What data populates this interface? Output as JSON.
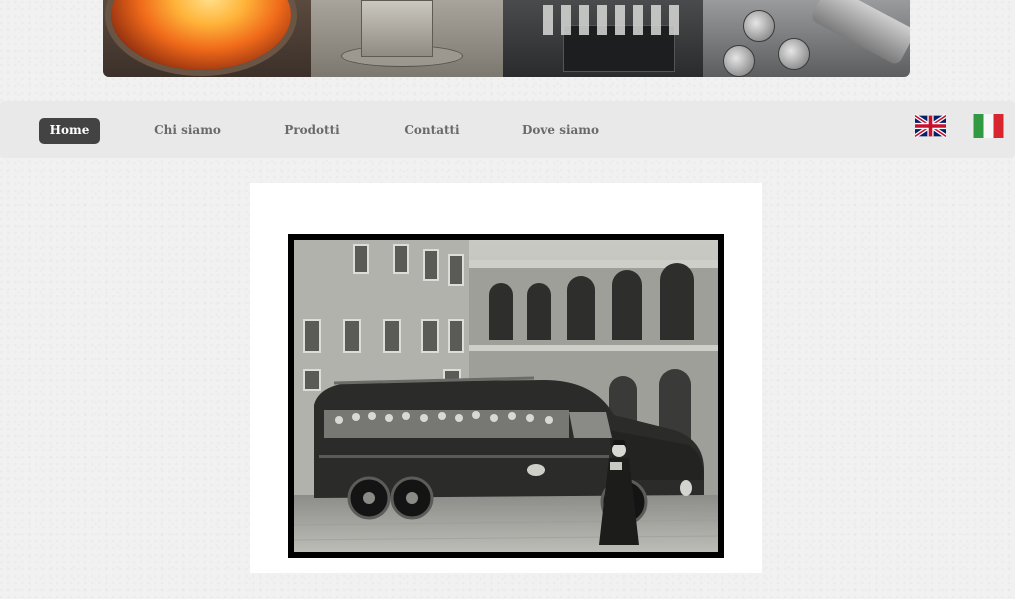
{
  "banner": {
    "panels": [
      "furnace-photo",
      "machine-photo",
      "metal-parts-photo",
      "tools-photo"
    ]
  },
  "nav": {
    "items": [
      {
        "label": "Home",
        "active": true
      },
      {
        "label": "Chi siamo",
        "active": false
      },
      {
        "label": "Prodotti",
        "active": false
      },
      {
        "label": "Contatti",
        "active": false
      },
      {
        "label": "Dove siamo",
        "active": false
      }
    ],
    "languages": [
      {
        "icon": "uk-flag-icon"
      },
      {
        "icon": "italy-flag-icon"
      }
    ]
  },
  "content": {
    "photo": "vintage-bus-photo"
  },
  "colors": {
    "nav_bg": "#e9e9e9",
    "nav_active_bg": "#434343",
    "nav_text": "#6a6a6a",
    "page_bg": "#f1f1f1"
  }
}
